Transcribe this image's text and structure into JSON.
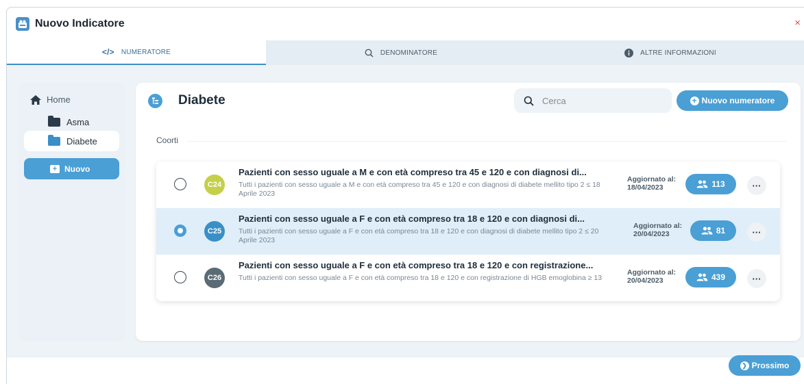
{
  "window": {
    "title": "Nuovo Indicatore",
    "close_icon": "close-icon",
    "close_label": "×"
  },
  "tabs": [
    {
      "label": "NUMERATORE",
      "icon": "code-icon",
      "icon_glyph": "</>",
      "active": true
    },
    {
      "label": "DENOMINATORE",
      "icon": "search-icon",
      "active": false
    },
    {
      "label": "ALTRE INFORMAZIONI",
      "icon": "info-icon",
      "active": false
    }
  ],
  "sidebar": {
    "home": {
      "label": "Home",
      "icon": "home-icon"
    },
    "items": [
      {
        "label": "Asma",
        "icon": "folder-icon"
      },
      {
        "label": "Diabete",
        "icon": "folder-icon",
        "selected": true
      }
    ],
    "new_button": {
      "label": "Nuovo",
      "icon": "plus-folder-icon",
      "glyph": "+"
    }
  },
  "panel": {
    "title": "Diabete",
    "icon": "hierarchy-icon",
    "search": {
      "placeholder": "Cerca",
      "value": ""
    },
    "new_button": {
      "label": "Nuovo numeratore",
      "icon": "plus-circle-icon",
      "glyph": "+"
    },
    "section_label": "Coorti"
  },
  "cohorts": [
    {
      "code": "C24",
      "badge_color": "#c5cf4a",
      "title": "Pazienti con sesso uguale a M e con età compreso tra 45 e 120 e con diagnosi di...",
      "description": "Tutti i pazienti con sesso uguale a M e con età compreso tra 45 e 120 e con diagnosi di diabete mellito tipo 2 ≤ 18 Aprile 2023",
      "updated_label": "Aggiornato al:",
      "updated_date": "18/04/2023",
      "count": "113",
      "more_label": "···",
      "selected": false
    },
    {
      "code": "C25",
      "badge_color": "#3a8fc6",
      "title": "Pazienti con sesso uguale a F e con età compreso tra 18 e 120 e con diagnosi di...",
      "description": "Tutti i pazienti con sesso uguale a F e con età compreso tra 18 e 120 e con diagnosi di diabete mellito tipo 2 ≤ 20 Aprile 2023",
      "updated_label": "Aggiornato al:",
      "updated_date": "20/04/2023",
      "count": "81",
      "more_label": "···",
      "selected": true
    },
    {
      "code": "C26",
      "badge_color": "#5b6b76",
      "title": "Pazienti con sesso uguale a F e con età compreso tra 18 e 120 e con registrazione...",
      "description": "Tutti i pazienti con sesso uguale a F e con età compreso tra 18 e 120 e con registrazione di HGB emoglobina ≥ 13",
      "updated_label": "Aggiornato al:",
      "updated_date": "20/04/2023",
      "count": "439",
      "more_label": "···",
      "selected": false
    }
  ],
  "footer": {
    "next_label": "Prossimo",
    "next_icon": "arrow-right-circle-icon",
    "next_glyph": "❯"
  },
  "colors": {
    "accent": "#4a9fd5",
    "close": "#e74c3c",
    "selected_row": "#dfeef8"
  }
}
